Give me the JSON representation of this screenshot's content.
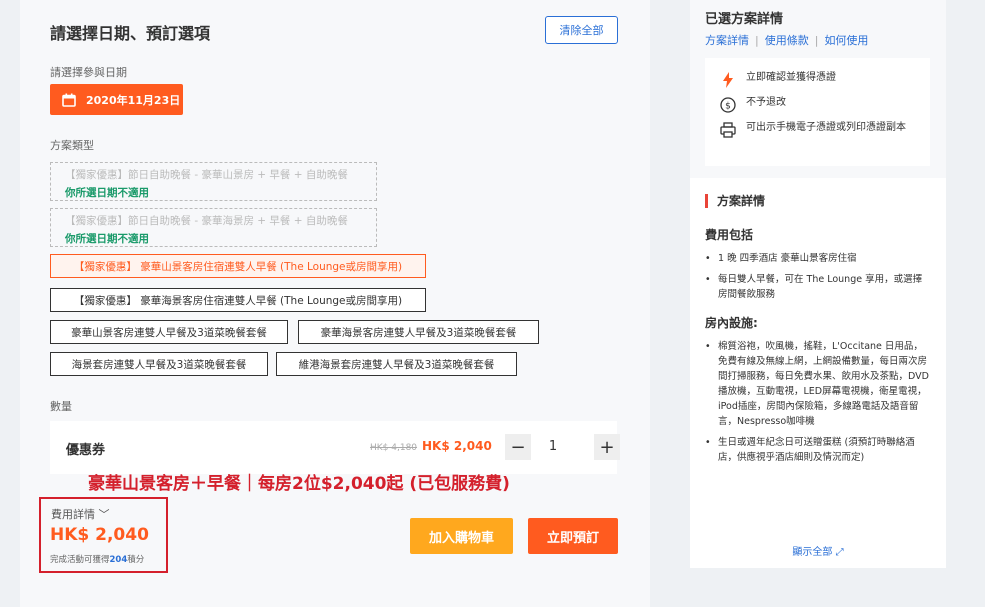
{
  "left": {
    "title": "請選擇日期、預訂選項",
    "clear_label": "清除全部",
    "date_section_label": "請選擇參與日期",
    "date_value": "2020年11月23日",
    "type_section_label": "方案類型",
    "disabled_options": [
      {
        "label": "【獨家優惠】節日自助晚餐 - 豪華山景房 + 早餐 + 自助晚餐",
        "note": "你所選日期不適用"
      },
      {
        "label": "【獨家優惠】節日自助晚餐 - 豪華海景房 + 早餐 + 自助晚餐",
        "note": "你所選日期不適用"
      }
    ],
    "options": [
      "【獨家優惠】 豪華山景客房住宿連雙人早餐 (The Lounge或房間享用)",
      "【獨家優惠】 豪華海景客房住宿連雙人早餐 (The Lounge或房間享用)",
      "豪華山景客房連雙人早餐及3道菜晚餐套餐",
      "豪華海景客房連雙人早餐及3道菜晚餐套餐",
      "海景套房連雙人早餐及3道菜晚餐套餐",
      "維港海景套房連雙人早餐及3道菜晚餐套餐"
    ],
    "qty_section_label": "數量",
    "qty": {
      "name": "優惠券",
      "old_price": "HK$ 4,180",
      "new_price": "HK$ 2,040",
      "minus": "−",
      "value": "1",
      "plus": "+"
    },
    "promo_text": "豪華山景客房＋早餐｜每房2位$2,040起 (已包服務費)",
    "price_label": "費用詳情",
    "price_value": "HK$ 2,040",
    "price_note_pre": "完成活動可獲得",
    "price_note_points": "204",
    "price_note_post": "積分",
    "cart_label": "加入購物車",
    "book_label": "立即預訂"
  },
  "right": {
    "title": "已選方案詳情",
    "links": [
      "方案詳情",
      "使用條款",
      "如何使用"
    ],
    "features": [
      "立即確認並獲得憑證",
      "不予退改",
      "可出示手機電子憑證或列印憑證副本"
    ],
    "section_title": "方案詳情",
    "fee_title": "費用包括",
    "fee_items": [
      "1 晚 四季酒店 豪華山景客房住宿",
      "每日雙人早餐，可在 The Lounge 享用，或選擇房間餐飲服務"
    ],
    "facility_title": "房內設施:",
    "facility_items": [
      "棉質浴袍，吹風機，搖鞋，L'Occitane 日用品，免費有線及無線上網，上網設備數量，每日兩次房間打掃服務，每日免費水果、飲用水及茶點，DVD 播放機，互動電視，LED屏幕電視機，衛星電視，iPod插座，房間內保險箱，多線路電話及語音留言，Nespresso咖啡機",
      "生日或週年紀念日可送贈蛋糕 (須預訂時聯絡酒店，供應視乎酒店細則及情況而定)"
    ],
    "more_label": "顯示全部 ⤢"
  },
  "colors": {
    "accent": "#ff5b1f",
    "link": "#2a6fd6",
    "promo": "#d4202c",
    "cart": "#ffa81e"
  }
}
